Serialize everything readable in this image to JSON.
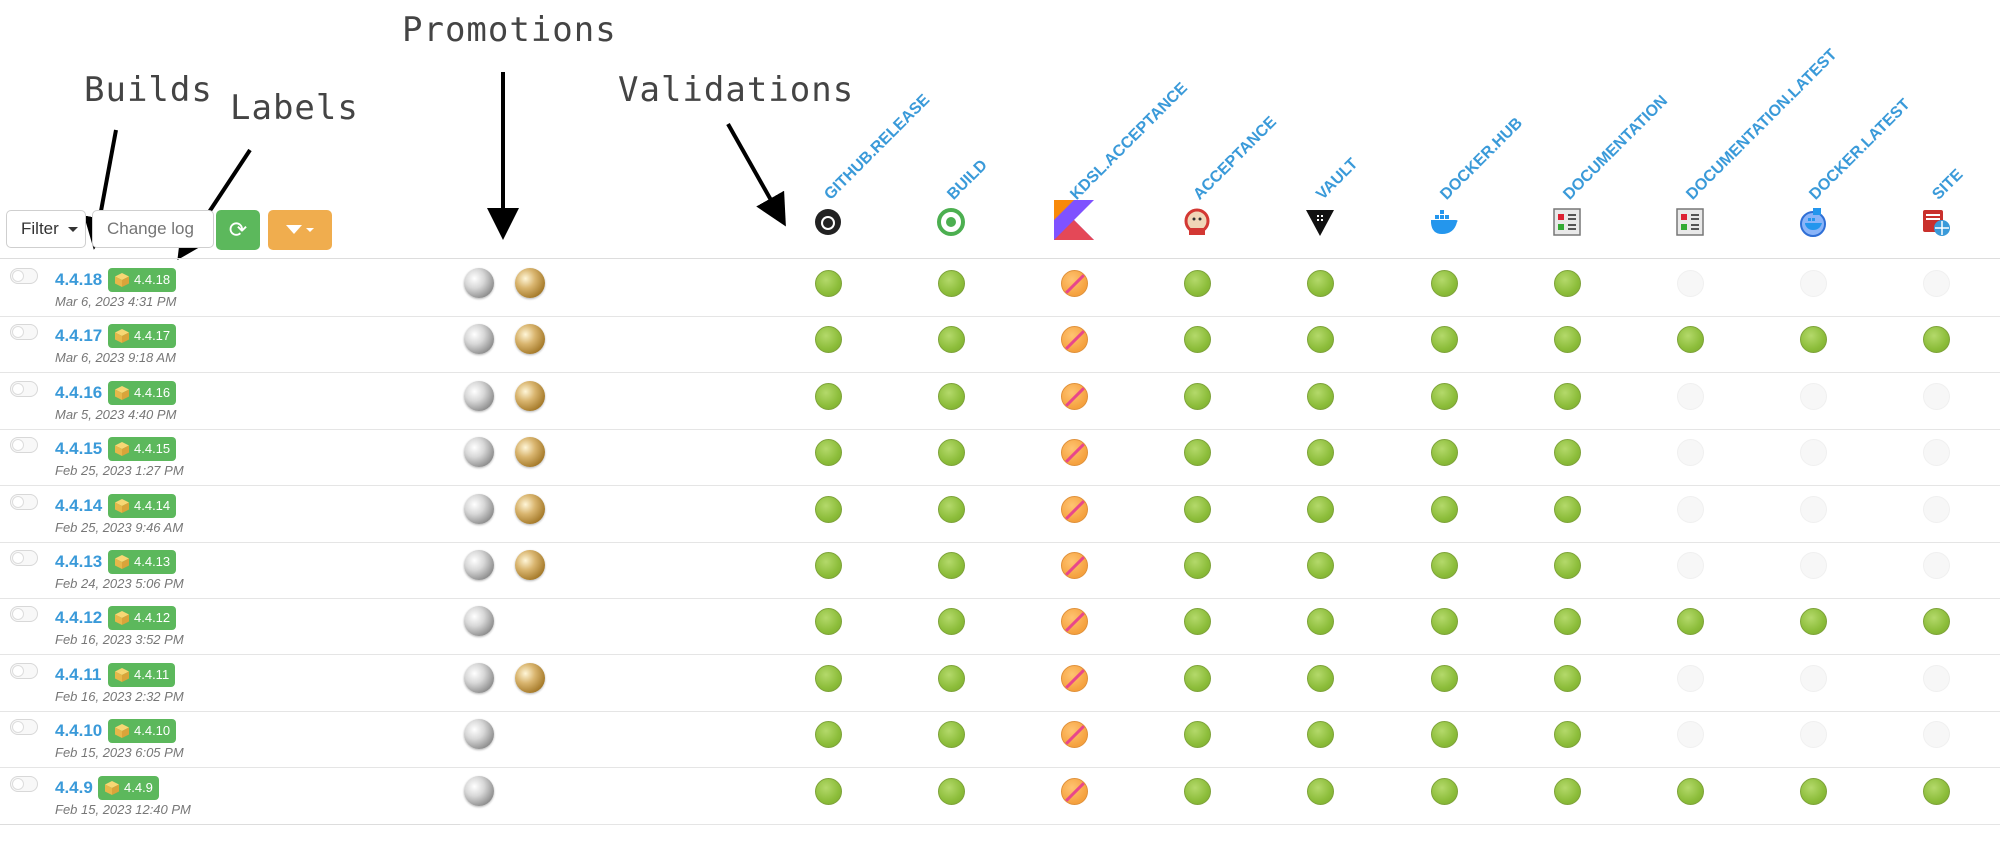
{
  "annotations": {
    "builds": "Builds",
    "labels": "Labels",
    "promotions": "Promotions",
    "validations": "Validations"
  },
  "toolbar": {
    "filter_label": "Filter",
    "change_log_placeholder": "Change log",
    "refresh_icon": "refresh-icon",
    "filter_menu_icon": "funnel-icon"
  },
  "colors": {
    "link": "#3a9ad9",
    "label_badge": "#5cb85c",
    "passed": "#8cbd3a",
    "warning": "#f5a13e",
    "refresh_button": "#5cb85c",
    "filter_menu_button": "#f0ad4e"
  },
  "validation_stamps": [
    {
      "name": "GITHUB.RELEASE",
      "icon": "github-icon"
    },
    {
      "name": "BUILD",
      "icon": "build-ring-icon"
    },
    {
      "name": "KDSL.ACCEPTANCE",
      "icon": "kotlin-icon"
    },
    {
      "name": "ACCEPTANCE",
      "icon": "jenkins-icon"
    },
    {
      "name": "VAULT",
      "icon": "vault-icon"
    },
    {
      "name": "DOCKER.HUB",
      "icon": "docker-icon"
    },
    {
      "name": "DOCUMENTATION",
      "icon": "documentation-icon"
    },
    {
      "name": "DOCUMENTATION.LATEST",
      "icon": "documentation-icon"
    },
    {
      "name": "DOCKER.LATEST",
      "icon": "docker-latest-icon"
    },
    {
      "name": "SITE",
      "icon": "site-icon"
    }
  ],
  "builds": [
    {
      "name": "4.4.18",
      "label": "4.4.18",
      "date": "Mar 6, 2023 4:31 PM",
      "promotions": [
        "silver",
        "gold"
      ],
      "validations": [
        "passed",
        "passed",
        "warning",
        "passed",
        "passed",
        "passed",
        "passed",
        "none",
        "none",
        "none"
      ]
    },
    {
      "name": "4.4.17",
      "label": "4.4.17",
      "date": "Mar 6, 2023 9:18 AM",
      "promotions": [
        "silver",
        "gold"
      ],
      "validations": [
        "passed",
        "passed",
        "warning",
        "passed",
        "passed",
        "passed",
        "passed",
        "passed",
        "passed",
        "passed"
      ]
    },
    {
      "name": "4.4.16",
      "label": "4.4.16",
      "date": "Mar 5, 2023 4:40 PM",
      "promotions": [
        "silver",
        "gold"
      ],
      "validations": [
        "passed",
        "passed",
        "warning",
        "passed",
        "passed",
        "passed",
        "passed",
        "none",
        "none",
        "none"
      ]
    },
    {
      "name": "4.4.15",
      "label": "4.4.15",
      "date": "Feb 25, 2023 1:27 PM",
      "promotions": [
        "silver",
        "gold"
      ],
      "validations": [
        "passed",
        "passed",
        "warning",
        "passed",
        "passed",
        "passed",
        "passed",
        "none",
        "none",
        "none"
      ]
    },
    {
      "name": "4.4.14",
      "label": "4.4.14",
      "date": "Feb 25, 2023 9:46 AM",
      "promotions": [
        "silver",
        "gold"
      ],
      "validations": [
        "passed",
        "passed",
        "warning",
        "passed",
        "passed",
        "passed",
        "passed",
        "none",
        "none",
        "none"
      ]
    },
    {
      "name": "4.4.13",
      "label": "4.4.13",
      "date": "Feb 24, 2023 5:06 PM",
      "promotions": [
        "silver",
        "gold"
      ],
      "validations": [
        "passed",
        "passed",
        "warning",
        "passed",
        "passed",
        "passed",
        "passed",
        "none",
        "none",
        "none"
      ]
    },
    {
      "name": "4.4.12",
      "label": "4.4.12",
      "date": "Feb 16, 2023 3:52 PM",
      "promotions": [
        "silver"
      ],
      "validations": [
        "passed",
        "passed",
        "warning",
        "passed",
        "passed",
        "passed",
        "passed",
        "passed",
        "passed",
        "passed"
      ]
    },
    {
      "name": "4.4.11",
      "label": "4.4.11",
      "date": "Feb 16, 2023 2:32 PM",
      "promotions": [
        "silver",
        "gold"
      ],
      "validations": [
        "passed",
        "passed",
        "warning",
        "passed",
        "passed",
        "passed",
        "passed",
        "none",
        "none",
        "none"
      ]
    },
    {
      "name": "4.4.10",
      "label": "4.4.10",
      "date": "Feb 15, 2023 6:05 PM",
      "promotions": [
        "silver"
      ],
      "validations": [
        "passed",
        "passed",
        "warning",
        "passed",
        "passed",
        "passed",
        "passed",
        "none",
        "none",
        "none"
      ]
    },
    {
      "name": "4.4.9",
      "label": "4.4.9",
      "date": "Feb 15, 2023 12:40 PM",
      "promotions": [
        "silver"
      ],
      "validations": [
        "passed",
        "passed",
        "warning",
        "passed",
        "passed",
        "passed",
        "passed",
        "passed",
        "passed",
        "passed"
      ]
    }
  ]
}
